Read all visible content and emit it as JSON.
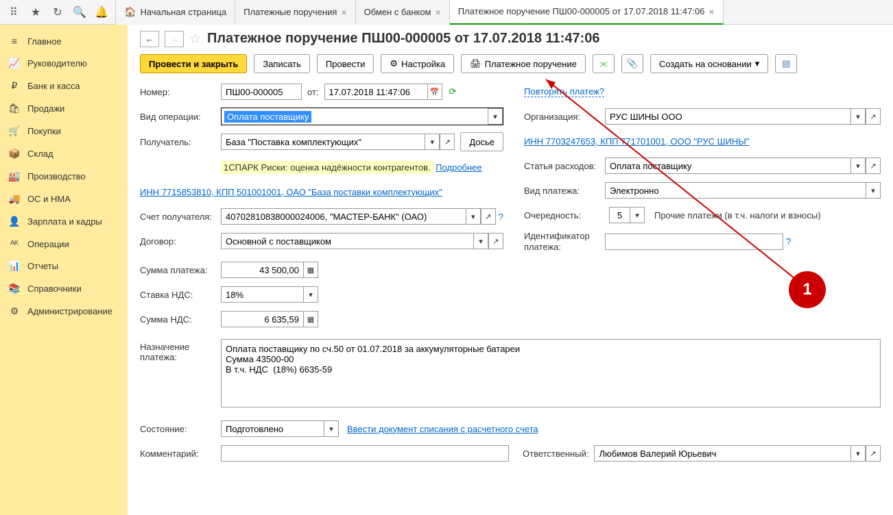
{
  "topIcons": [
    "apps",
    "star",
    "clock",
    "search",
    "bell"
  ],
  "tabs": [
    {
      "label": "Начальная страница",
      "home": true,
      "closable": false,
      "active": false
    },
    {
      "label": "Платежные поручения",
      "closable": true,
      "active": false
    },
    {
      "label": "Обмен с банком",
      "closable": true,
      "active": false
    },
    {
      "label": "Платежное поручение ПШ00-000005 от 17.07.2018 11:47:06",
      "closable": true,
      "active": true
    }
  ],
  "sidebar": [
    {
      "icon": "≡",
      "label": "Главное"
    },
    {
      "icon": "📈",
      "label": "Руководителю"
    },
    {
      "icon": "₽",
      "label": "Банк и касса"
    },
    {
      "icon": "🛍",
      "label": "Продажи"
    },
    {
      "icon": "🛒",
      "label": "Покупки"
    },
    {
      "icon": "📦",
      "label": "Склад"
    },
    {
      "icon": "🏭",
      "label": "Производство"
    },
    {
      "icon": "🚚",
      "label": "ОС и НМА"
    },
    {
      "icon": "👤",
      "label": "Зарплата и кадры"
    },
    {
      "icon": "ᴬᴷ",
      "label": "Операции"
    },
    {
      "icon": "📊",
      "label": "Отчеты"
    },
    {
      "icon": "📚",
      "label": "Справочники"
    },
    {
      "icon": "⚙",
      "label": "Администрирование"
    }
  ],
  "title": "Платежное поручение ПШ00-000005 от 17.07.2018 11:47:06",
  "toolbar": {
    "provesti_zakryt": "Провести и закрыть",
    "zapisat": "Записать",
    "provesti": "Провести",
    "nastroika": "Настройка",
    "plat_poruch": "Платежное поручение",
    "sozdat": "Создать на основании"
  },
  "labels": {
    "nomer": "Номер:",
    "ot": "от:",
    "vid_operacii": "Вид операции:",
    "poluchatel": "Получатель:",
    "schet_poluch": "Счет получателя:",
    "dogovor": "Договор:",
    "summa": "Сумма платежа:",
    "stavka_nds": "Ставка НДС:",
    "summa_nds": "Сумма НДС:",
    "naznachenie": "Назначение платежа:",
    "sostoyanie": "Состояние:",
    "kommentariy": "Комментарий:",
    "organizacia": "Организация:",
    "statya": "Статья расходов:",
    "vid_platezha": "Вид платежа:",
    "ocherednost": "Очередность:",
    "identifikator": "Идентификатор платежа:",
    "otvetstvenny": "Ответственный:",
    "dose": "Досье"
  },
  "values": {
    "nomer": "ПШ00-000005",
    "data": "17.07.2018 11:47:06",
    "vid_operacii": "Оплата поставщику",
    "poluchatel": "База \"Поставка комплектующих\"",
    "spark": "1СПАРК Риски: оценка надёжности контрагентов.",
    "podrobnee": "Подробнее",
    "inn_poluch": "ИНН 7715853810, КПП 501001001, ОАО \"База поставки комплектующих\"",
    "schet": "40702810838000024006, \"МАСТЕР-БАНК\" (ОАО)",
    "dogovor": "Основной с поставщиком",
    "summa": "43 500,00",
    "stavka_nds": "18%",
    "summa_nds": "6 635,59",
    "naznachenie": "Оплата поставщику по сч.50 от 01.07.2018 за аккумуляторные батареи\nСумма 43500-00\nВ т.ч. НДС  (18%) 6635-59",
    "sostoyanie": "Подготовлено",
    "vvesti_spisanie": "Ввести документ списания с расчетного счета",
    "povtoriat": "Повторять платеж?",
    "organizacia": "РУС ШИНЫ ООО",
    "inn_org": "ИНН 7703247653, КПП 771701001, ООО \"РУС ШИНЫ\"",
    "statya": "Оплата поставщику",
    "vid_platezha": "Электронно",
    "ocherednost": "5",
    "ocherednost_desc": "Прочие платежи (в т.ч. налоги и взносы)",
    "otvetstvenny": "Любимов Валерий Юрьевич"
  },
  "annotation": {
    "number": "1"
  }
}
